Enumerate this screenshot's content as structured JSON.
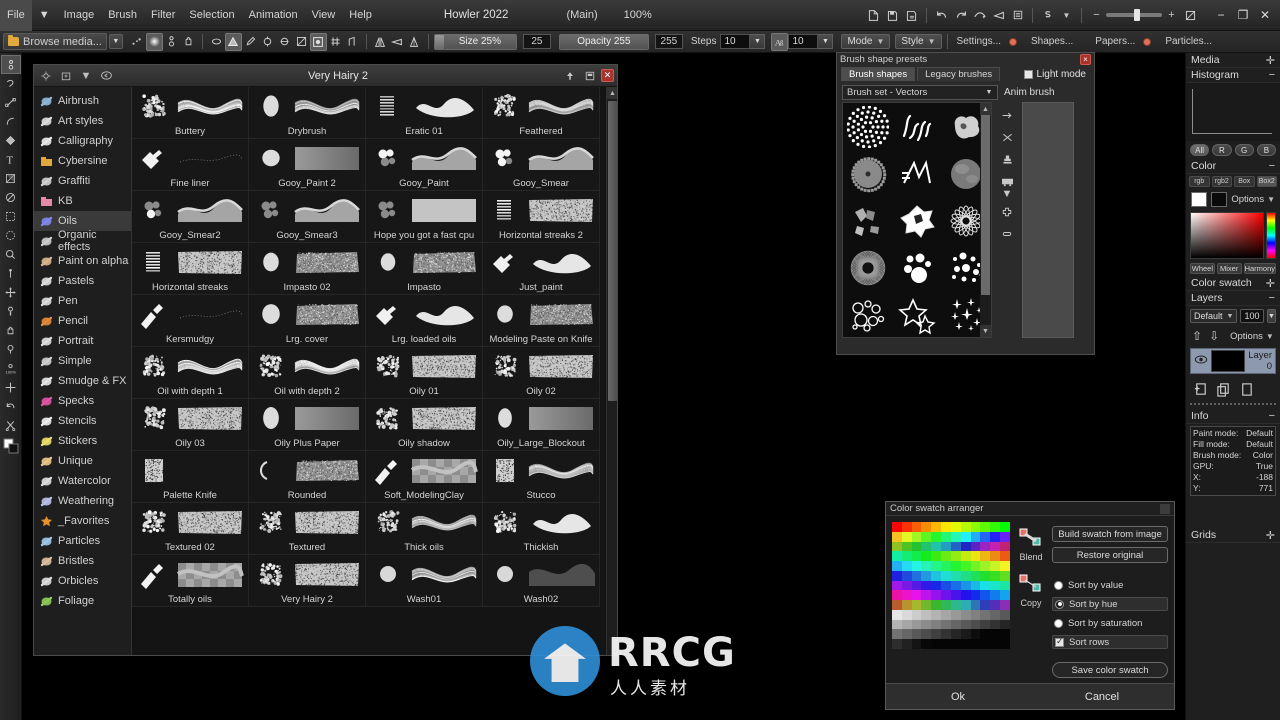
{
  "menubar": {
    "items": [
      "File",
      "Image",
      "Brush",
      "Filter",
      "Selection",
      "Animation",
      "View",
      "Help"
    ],
    "app_title": "Howler 2022",
    "doc_context": "(Main)",
    "zoom_level": "100%",
    "right_icons": [
      "new-file-icon",
      "save-file-icon",
      "save-as-icon",
      "undo-icon",
      "redo-icon",
      "redo-arrow-icon",
      "flip-icon",
      "list-icon",
      "snapshot-icon",
      "snapshot-dropdown-icon",
      "zoom-out-icon",
      "zoom-slider",
      "zoom-in-icon",
      "fullscreen-icon"
    ],
    "window_buttons": [
      "minimize",
      "maximize",
      "close"
    ]
  },
  "toolbar": {
    "browse_media_label": "Browse media...",
    "size_label": "Size 25%",
    "size_value": "25",
    "opacity_label": "Opacity 255",
    "opacity_value": "255",
    "steps_label": "Steps",
    "steps_value": "10",
    "jitter_value": "10",
    "mode_label": "Mode",
    "style_label": "Style",
    "settings_label": "Settings...",
    "shapes_label": "Shapes...",
    "papers_label": "Papers...",
    "particles_label": "Particles...",
    "icons": [
      "spray-icon",
      "soft-round-icon",
      "pressure-icon",
      "hand-icon",
      "smudge-icon",
      "paint-bucket-icon",
      "pencil-icon",
      "clone-icon",
      "blur-icon",
      "noise-icon",
      "stamp-icon",
      "grid-icon",
      "symmetry-icon",
      "flip-horizontal-icon",
      "flip-vertical-icon",
      "mirror-icon"
    ]
  },
  "left_tools": [
    "brush-tool",
    "lasso-tool",
    "line-tool",
    "curve-tool",
    "bucket-tool",
    "text-tool",
    "gradient-tool",
    "eraser-tool",
    "rect-select-tool",
    "ellipse-select-tool",
    "zoom-tool",
    "pin-tool",
    "move-tool",
    "dropper-tool",
    "hand-tool",
    "magnifier-tool",
    "percent-tool",
    "crosshair-tool",
    "undo-tool",
    "scissors-tool",
    "color-swatch-tool"
  ],
  "brush_window": {
    "title": "Very Hairy 2",
    "titlebar_icons": [
      "settings-gear-icon",
      "folder-dropdown-icon",
      "back-icon"
    ],
    "titlebar_right_icons": [
      "pin-icon",
      "dock-icon"
    ],
    "close_label": "×",
    "categories": [
      {
        "label": "Airbrush",
        "icon": "airbrush-icon",
        "color": "#8fb8d8"
      },
      {
        "label": "Art styles",
        "icon": "art-styles-icon",
        "color": "#dcdcdc"
      },
      {
        "label": "Calligraphy",
        "icon": "calligraphy-icon",
        "color": "#e8e8e8"
      },
      {
        "label": "Cybersine",
        "icon": "folder-icon",
        "color": "#e0a93c"
      },
      {
        "label": "Graffiti",
        "icon": "spraycan-icon",
        "color": "#cfcfcf"
      },
      {
        "label": "KB",
        "icon": "pink-folder-icon",
        "color": "#e58ba8"
      },
      {
        "label": "Oils",
        "icon": "oils-icon",
        "color": "#7f86e8"
      },
      {
        "label": "Organic effects",
        "icon": "organic-icon",
        "color": "#cccccc"
      },
      {
        "label": "Paint on alpha",
        "icon": "paint-alpha-icon",
        "color": "#d8b48c"
      },
      {
        "label": "Pastels",
        "icon": "pastels-icon",
        "color": "#dddddd"
      },
      {
        "label": "Pen",
        "icon": "pen-icon",
        "color": "#dcdcdc"
      },
      {
        "label": "Pencil",
        "icon": "pencil-icon",
        "color": "#e08a3c"
      },
      {
        "label": "Portrait",
        "icon": "portrait-icon",
        "color": "#dddddd"
      },
      {
        "label": "Simple",
        "icon": "simple-icon",
        "color": "#d0d0d0"
      },
      {
        "label": "Smudge & FX",
        "icon": "smudge-icon",
        "color": "#e4e4e4"
      },
      {
        "label": "Specks",
        "icon": "specks-icon",
        "color": "#e055a0"
      },
      {
        "label": "Stencils",
        "icon": "stencils-icon",
        "color": "#ececec"
      },
      {
        "label": "Stickers",
        "icon": "stickers-icon",
        "color": "#e8e06a"
      },
      {
        "label": "Unique",
        "icon": "unique-icon",
        "color": "#e8c48c"
      },
      {
        "label": "Watercolor",
        "icon": "watercolor-icon",
        "color": "#dcdcdc"
      },
      {
        "label": "Weathering",
        "icon": "weathering-icon",
        "color": "#b8c0e8"
      },
      {
        "label": "_Favorites",
        "icon": "star-icon",
        "color": "#e8902c"
      },
      {
        "label": "Particles",
        "icon": "particles-icon",
        "color": "#9fc8e8"
      },
      {
        "label": "Bristles",
        "icon": "bristles-icon",
        "color": "#d8c0a0"
      },
      {
        "label": "Orbicles",
        "icon": "orbicles-icon",
        "color": "#dcdcdc"
      },
      {
        "label": "Foliage",
        "icon": "foliage-icon",
        "color": "#8fc858"
      }
    ],
    "selected_category": "Oils",
    "brushes": [
      [
        "Buttery",
        "Drybrush",
        "Eratic 01",
        "Feathered"
      ],
      [
        "Fine liner",
        "Gooy_Paint 2",
        "Gooy_Paint",
        "Gooy_Smear"
      ],
      [
        "Gooy_Smear2",
        "Gooy_Smear3",
        "Hope you got a fast cpu",
        "Horizontal streaks 2"
      ],
      [
        "Horizontal streaks",
        "Impasto 02",
        "Impasto",
        "Just_paint"
      ],
      [
        "Kersmudgy",
        "Lrg. cover",
        "Lrg. loaded oils",
        "Modeling Paste on Knife"
      ],
      [
        "Oil with depth 1",
        "Oil with depth 2",
        "Oily 01",
        "Oily 02"
      ],
      [
        "Oily 03",
        "Oily Plus Paper",
        "Oily shadow",
        "Oily_Large_Blockout"
      ],
      [
        "Palette Knife",
        "Rounded",
        "Soft_ModelingClay",
        "Stucco"
      ],
      [
        "Textured 02",
        "Textured",
        "Thick oils",
        "Thickish"
      ],
      [
        "Totally oils",
        "Very Hairy 2",
        "Wash01",
        "Wash02"
      ]
    ]
  },
  "brush_presets": {
    "title": "Brush shape presets",
    "close_label": "×",
    "tabs": [
      {
        "label": "Brush shapes",
        "active": true
      },
      {
        "label": "Legacy brushes",
        "active": false
      }
    ],
    "light_mode_label": "Light mode",
    "light_mode_checked": false,
    "brush_set_value": "Brush set - Vectors",
    "anim_brush_label": "Anim brush",
    "shape_icons": [
      [
        "dots-ring-shape",
        "squiggles-shape",
        "cloud-blob-shape"
      ],
      [
        "gear-shape",
        "zigzag-shape",
        "soft-sphere-shape"
      ],
      [
        "fragments-shape",
        "star-burst-shape",
        "flower-petal-shape"
      ],
      [
        "spiro-disc-shape",
        "paw-dots-shape",
        "scatter-dots-shape"
      ],
      [
        "bubbles-shape",
        "stars-outline-shape",
        "sparkles-shape"
      ]
    ],
    "side_icons": [
      "move-icon",
      "shuffle-icon",
      "stamp-icon",
      "camera-icon",
      "camera-dropdown-icon",
      "plus-icon",
      "minus-icon"
    ]
  },
  "color_swatch_arranger": {
    "title": "Color swatch arranger",
    "blend_label": "Blend",
    "copy_label": "Copy",
    "buttons": {
      "build": "Build swatch from image",
      "restore": "Restore original",
      "save": "Save color swatch"
    },
    "sort_options": [
      {
        "label": "Sort by value",
        "selected": false
      },
      {
        "label": "Sort by hue",
        "selected": true
      },
      {
        "label": "Sort by saturation",
        "selected": false
      }
    ],
    "sort_rows_label": "Sort rows",
    "sort_rows_checked": true,
    "ok_label": "Ok",
    "cancel_label": "Cancel"
  },
  "right_panel": {
    "media_label": "Media",
    "histogram_label": "Histogram",
    "channel_buttons": [
      {
        "label": "All",
        "on": true
      },
      {
        "label": "R",
        "on": false
      },
      {
        "label": "G",
        "on": false
      },
      {
        "label": "B",
        "on": false
      }
    ],
    "color_label": "Color",
    "color_tabs": [
      {
        "label": "rgb",
        "on": false
      },
      {
        "label": "rgb2",
        "on": false
      },
      {
        "label": "Box",
        "on": false
      },
      {
        "label": "Box2",
        "on": true
      }
    ],
    "options_label": "Options",
    "picker_tabs": [
      "Wheel",
      "Mixer",
      "Harmony"
    ],
    "color_swatch_label": "Color swatch",
    "layers_label": "Layers",
    "blend_mode": "Default",
    "layer_opacity": "100",
    "layer_options_label": "Options",
    "layer_name": "Layer 0",
    "info_label": "Info",
    "info_rows": [
      {
        "key": "Paint mode:",
        "value": "Default"
      },
      {
        "key": "Fill mode:",
        "value": "Default"
      },
      {
        "key": "Brush mode:",
        "value": "Color"
      },
      {
        "key": "GPU:",
        "value": "True"
      },
      {
        "key": "X:",
        "value": "-188"
      },
      {
        "key": "Y:",
        "value": "771"
      }
    ],
    "grids_label": "Grids"
  },
  "watermark": {
    "text": "RRCG",
    "subtext": "人人素材"
  },
  "colors": {
    "accent_red": "#a8322c",
    "orange": "#e0a93c",
    "panel_bg": "#1f1f1f",
    "toolbar_bg": "#2f2f2f"
  }
}
